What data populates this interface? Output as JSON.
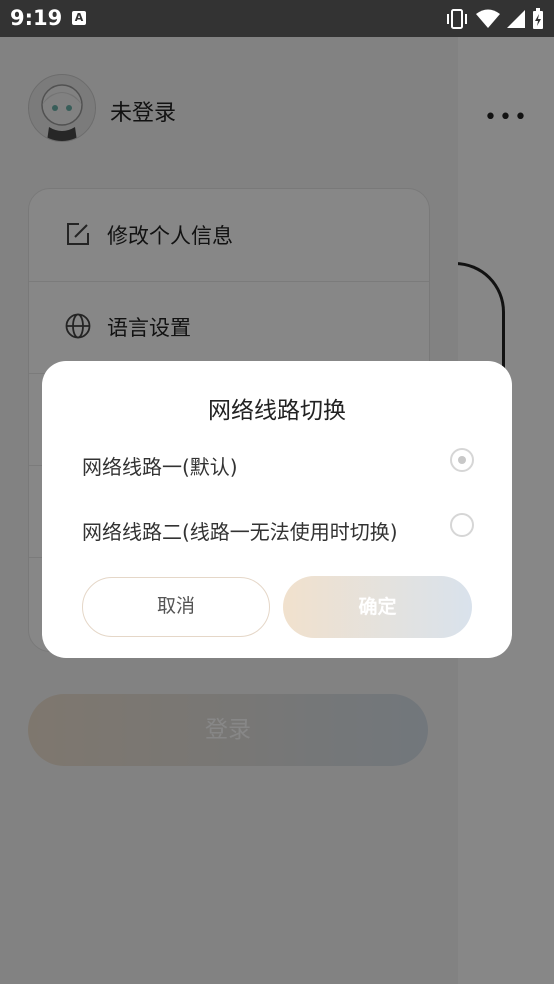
{
  "status_bar": {
    "time": "9:19",
    "notification_icon": "A"
  },
  "drawer": {
    "username": "未登录",
    "menu": [
      {
        "label": "修改个人信息",
        "icon": "edit-icon"
      },
      {
        "label": "语言设置",
        "icon": "globe-icon"
      }
    ],
    "login_label": "登录"
  },
  "background": {
    "more_label": "•••"
  },
  "dialog": {
    "title": "网络线路切换",
    "options": [
      {
        "label": "网络线路一(默认)",
        "selected": true
      },
      {
        "label": "网络线路二(线路一无法使用时切换)",
        "selected": false
      }
    ],
    "cancel_label": "取消",
    "confirm_label": "确定"
  }
}
